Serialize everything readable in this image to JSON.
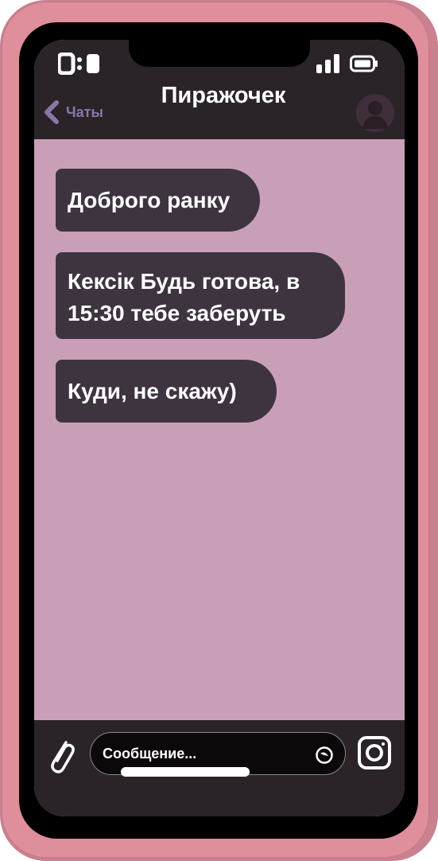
{
  "header": {
    "title": "Пиражочек",
    "back_label": "Чаты"
  },
  "messages": [
    {
      "text": "Доброго ранку"
    },
    {
      "text": "Кексік Будь готова, в 15:30 тебе заберуть"
    },
    {
      "text": "Куди, не скажу)"
    }
  ],
  "composer": {
    "placeholder": "Сообщение..."
  },
  "colors": {
    "case": "#df8e9b",
    "chat_background": "#c99fb7",
    "bar_background": "#2a2429",
    "bubble": "#3e3440",
    "accent": "#8a77a8"
  },
  "icons": [
    "back-chevron-icon",
    "signal-icon",
    "battery-icon",
    "avatar-icon",
    "paperclip-icon",
    "sticker-icon",
    "camera-icon"
  ]
}
